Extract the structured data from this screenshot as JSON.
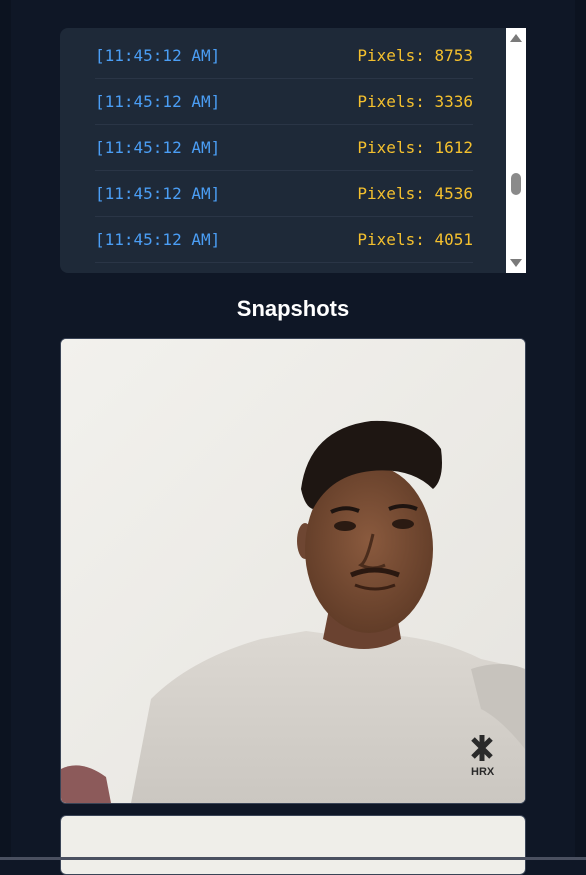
{
  "log": {
    "entries": [
      {
        "time": "[11:45:12 AM]",
        "pixels": "Pixels: 8753"
      },
      {
        "time": "[11:45:12 AM]",
        "pixels": "Pixels: 3336"
      },
      {
        "time": "[11:45:12 AM]",
        "pixels": "Pixels: 1612"
      },
      {
        "time": "[11:45:12 AM]",
        "pixels": "Pixels: 4536"
      },
      {
        "time": "[11:45:12 AM]",
        "pixels": "Pixels: 4051"
      }
    ]
  },
  "snapshots": {
    "title": "Snapshots",
    "items": [
      {
        "shirt_logo_text": "HRX"
      }
    ]
  },
  "colors": {
    "background": "#0f1726",
    "panel": "#1e2938",
    "timestamp": "#4b9ef5",
    "pixels": "#f4c02e"
  }
}
